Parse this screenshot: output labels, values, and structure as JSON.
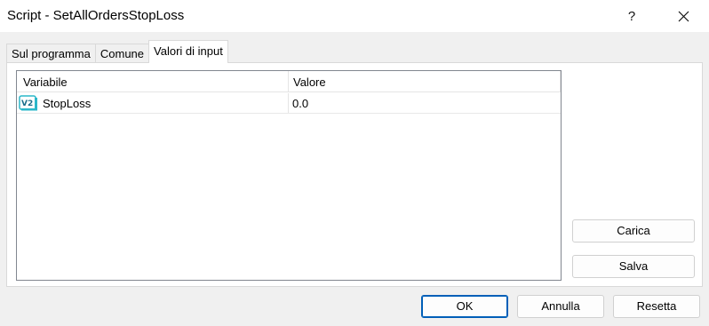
{
  "window": {
    "title": "Script - SetAllOrdersStopLoss",
    "help_label": "?",
    "close_icon": "close-icon"
  },
  "tabs": [
    {
      "label": "Sul programma",
      "active": false
    },
    {
      "label": "Comune",
      "active": false
    },
    {
      "label": "Valori di input",
      "active": true
    }
  ],
  "table": {
    "columns": [
      "Variabile",
      "Valore"
    ],
    "rows": [
      {
        "icon": "double-param-icon",
        "icon_text": "V2",
        "variable": "StopLoss",
        "value": "0.0"
      }
    ]
  },
  "side_buttons": {
    "load_label": "Carica",
    "save_label": "Salva"
  },
  "footer": {
    "ok_label": "OK",
    "cancel_label": "Annulla",
    "reset_label": "Resetta"
  },
  "colors": {
    "accent": "#005fb8",
    "icon_teal": "#2bb7c9"
  }
}
